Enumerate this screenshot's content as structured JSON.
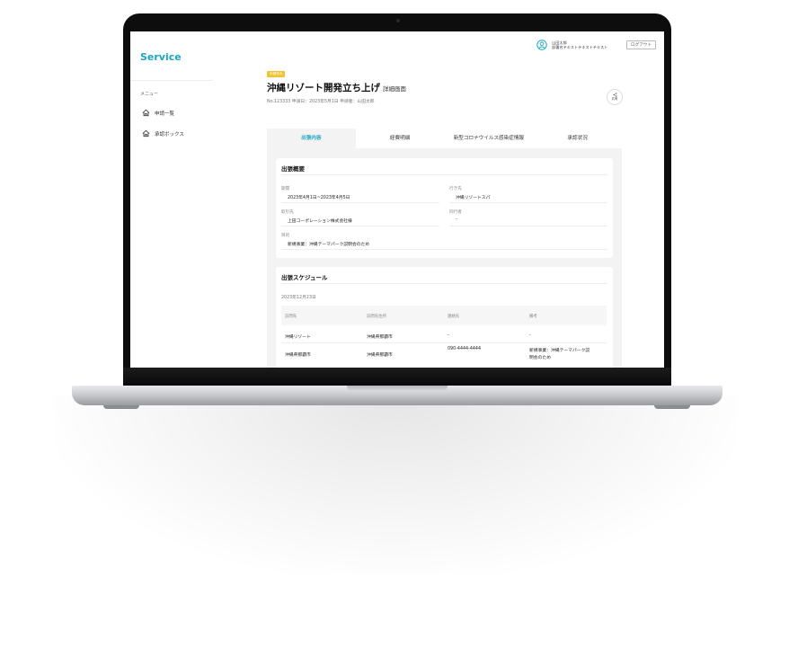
{
  "app": {
    "brand": "Service"
  },
  "user": {
    "name": "山田太郎",
    "dept": "部署名テキストテキストテキスト",
    "logout_label": "ログアウト"
  },
  "sidebar": {
    "menu_label": "メニュー",
    "items": [
      {
        "label": "申請一覧",
        "icon": "home-icon"
      },
      {
        "label": "承認ボックス",
        "icon": "home-icon"
      }
    ]
  },
  "header": {
    "badge": "申請済み",
    "title": "沖縄リゾート開発立ち上げ",
    "title_suffix": "詳細画面",
    "meta": "No.123333  申請日：2023年5月1日  申請者：山田太郎",
    "share_label": "共有"
  },
  "tabs": [
    {
      "label": "出張内容",
      "active": true
    },
    {
      "label": "経費明細",
      "active": false
    },
    {
      "label": "新型コロナウイルス感染症情報",
      "active": false
    },
    {
      "label": "承認状況",
      "active": false
    }
  ],
  "overview": {
    "title": "出張概要",
    "period_label": "期間",
    "period_value": "2023年4月1日~2023年4月5日",
    "dest_label": "行き先",
    "dest_value": "沖縄リゾートスパ",
    "client_label": "取引先",
    "client_value": "上田コーポレーション株式会社様",
    "companion_label": "同行者",
    "companion_value": "-",
    "purpose_label": "目的",
    "purpose_value": "新規事業：沖縄テーマパーク説明会のため"
  },
  "schedule": {
    "title": "出張スケジュール",
    "date": "2023年12月23日",
    "headers": [
      "訪問先",
      "訪問先住所",
      "連絡先",
      "備考"
    ],
    "rows": [
      [
        "沖縄リゾート",
        "沖縄県那覇市",
        "-",
        "-"
      ],
      [
        "沖縄県那覇市",
        "沖縄県那覇市",
        "090-4444-4444",
        "新規事業：沖縄テーマパーク説",
        "明会のため"
      ]
    ]
  },
  "colors": {
    "accent": "#1aa6c3",
    "badge": "#f2c230"
  }
}
